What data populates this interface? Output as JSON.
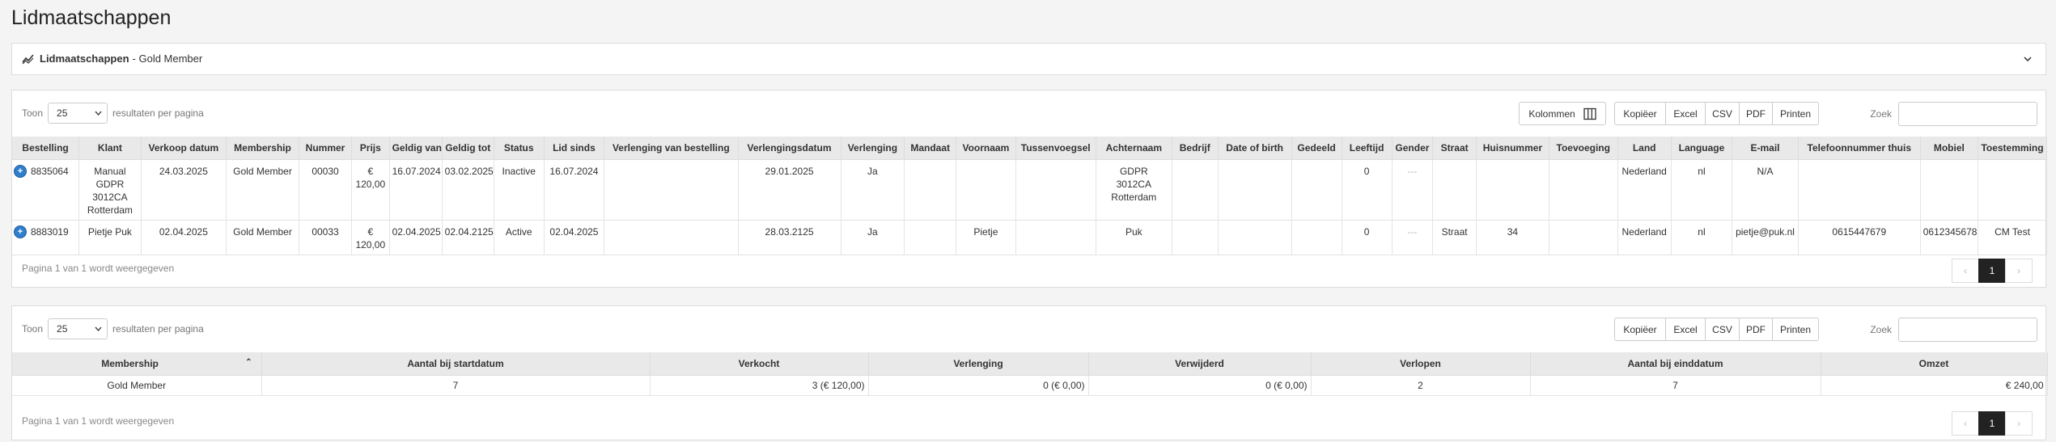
{
  "page": {
    "title": "Lidmaatschappen"
  },
  "breadcrumb": {
    "section": "Lidmaatschappen",
    "subtitle": "- Gold Member"
  },
  "table1": {
    "show_label": "Toon",
    "length_value": "25",
    "per_page_label": "resultaten per pagina",
    "columns_button": "Kolommen",
    "export_buttons": [
      "Kopiëer",
      "Excel",
      "CSV",
      "PDF",
      "Printen"
    ],
    "search_label": "Zoek",
    "headers": [
      "Bestelling",
      "Klant",
      "Verkoop datum",
      "Membership",
      "Nummer",
      "Prijs",
      "Geldig van",
      "Geldig tot",
      "Status",
      "Lid sinds",
      "Verlenging van bestelling",
      "Verlengingsdatum",
      "Verlenging",
      "Mandaat",
      "Voornaam",
      "Tussenvoegsel",
      "Achternaam",
      "Bedrijf",
      "Date of birth",
      "Gedeeld",
      "Leeftijd",
      "Gender",
      "Straat",
      "Huisnummer",
      "Toevoeging",
      "Land",
      "Language",
      "E-mail",
      "Telefoonnummer thuis",
      "Mobiel",
      "Toestemming"
    ],
    "rows": [
      [
        "8835064",
        "Manual\nGDPR\n3012CA\nRotterdam",
        "24.03.2025",
        "Gold Member",
        "00030",
        "€ 120,00",
        "16.07.2024",
        "03.02.2025",
        "Inactive",
        "16.07.2024",
        "",
        "29.01.2025",
        "Ja",
        "",
        "",
        "",
        "GDPR\n3012CA\nRotterdam",
        "",
        "",
        "",
        "0",
        "---",
        "",
        "",
        "",
        "Nederland",
        "nl",
        "N/A",
        "",
        "",
        ""
      ],
      [
        "8883019",
        "Pietje Puk",
        "02.04.2025",
        "Gold Member",
        "00033",
        "€ 120,00",
        "02.04.2025",
        "02.04.2125",
        "Active",
        "02.04.2025",
        "",
        "28.03.2125",
        "Ja",
        "",
        "Pietje",
        "",
        "Puk",
        "",
        "",
        "",
        "0",
        "---",
        "Straat",
        "34",
        "",
        "Nederland",
        "nl",
        "pietje@puk.nl",
        "0615447679",
        "0612345678",
        "CM Test"
      ]
    ],
    "footer_info": "Pagina 1 van 1 wordt weergegeven",
    "pager": {
      "prev": "‹",
      "current": "1",
      "next": "›"
    }
  },
  "table2": {
    "show_label": "Toon",
    "length_value": "25",
    "per_page_label": "resultaten per pagina",
    "export_buttons": [
      "Kopiëer",
      "Excel",
      "CSV",
      "PDF",
      "Printen"
    ],
    "search_label": "Zoek",
    "headers": [
      "Membership",
      "Aantal bij startdatum",
      "Verkocht",
      "Verlenging",
      "Verwijderd",
      "Verlopen",
      "Aantal bij einddatum",
      "Omzet"
    ],
    "sort_indicator": "⌃",
    "rows": [
      [
        "Gold Member",
        "7",
        "3 (€ 120,00)",
        "0 (€ 0,00)",
        "0 (€ 0,00)",
        "2",
        "7",
        "€ 240,00"
      ]
    ],
    "footer_info": "Pagina 1 van 1 wordt weergegeven",
    "pager": {
      "prev": "‹",
      "current": "1",
      "next": "›"
    }
  },
  "icons": {
    "breadcrumb": "chart-line-icon",
    "collapse": "chevron-down-icon",
    "columns": "columns-icon",
    "expand_row": "plus-circle-icon"
  }
}
